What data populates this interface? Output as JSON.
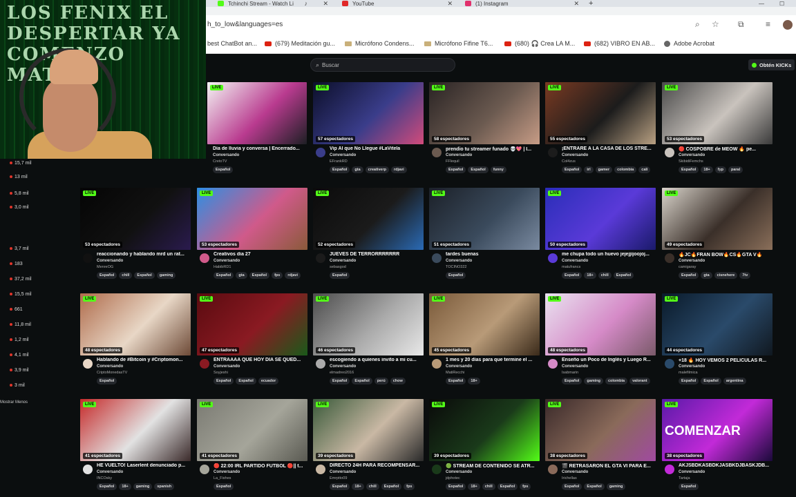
{
  "browser": {
    "tabs": [
      {
        "label": "Tchinchi Stream - Watch Li",
        "color": "#53fc18"
      },
      {
        "label": "YouTube",
        "color": "#e02828"
      },
      {
        "label": "(1) Instagram",
        "color": "#e1306c"
      }
    ],
    "new_tab": "+",
    "address": "h_to_low&languages=es",
    "bookmarks": [
      {
        "label": "best ChatBot an...",
        "icon": "none"
      },
      {
        "label": "(679) Meditación gu...",
        "icon": "youtube-icon"
      },
      {
        "label": "Micrófono Condens...",
        "icon": "folder-icon"
      },
      {
        "label": "Micrófono Fifine T6...",
        "icon": "folder-icon"
      },
      {
        "label": "(680) 🎧 Crea LA M...",
        "icon": "youtube-icon"
      },
      {
        "label": "(682) VIBRO EN AB...",
        "icon": "youtube-icon"
      },
      {
        "label": "Adobe Acrobat",
        "icon": "globe-icon"
      }
    ]
  },
  "webcam": {
    "overlay_text": "LOS FENIX EL DESPERTAR YA COMENZO MATRIX"
  },
  "header": {
    "search_placeholder": "Buscar",
    "kicks_button": "Obtén KICKs"
  },
  "sidebar": {
    "viewer_counts": [
      "15,7 mil",
      "13 mil",
      "5,8 mil",
      "3,0 mil",
      "3,7 mil",
      "183",
      "37,2 mil",
      "15,5 mil",
      "661",
      "11,8 mil",
      "1,2 mil",
      "4,1 mil",
      "3,9 mil",
      "3 mil"
    ],
    "show_less": "Mostrar Menos"
  },
  "streams": [
    {
      "viewers": "",
      "title": "Día de lluvia y conversa | Encerrado...",
      "category": "Conversando",
      "channel": "CretoTV",
      "tags": [
        "Español"
      ],
      "colors": [
        "#f4f4f4",
        "#b93b8f",
        "#1d1f24"
      ]
    },
    {
      "viewers": "57 espectadores",
      "title": "Vip Al que No Llegue #LaVitela",
      "category": "Conversando",
      "channel": "EFrankRD",
      "tags": [
        "Español",
        "gta",
        "creativerp",
        "rdjavi"
      ],
      "colors": [
        "#0c0f2a",
        "#3a3d8a",
        "#d24b7b"
      ]
    },
    {
      "viewers": "58 espectadores",
      "title": "prendio tu streamer funado 💀💖 | I...",
      "category": "Conversando",
      "channel": "FFlequil",
      "tags": [
        "Español",
        "Español",
        "funny"
      ],
      "colors": [
        "#2a2424",
        "#6b5a50",
        "#c79c86"
      ]
    },
    {
      "viewers": "55 espectadores",
      "title": "¡ENTRARE A LA CASA DE LOS STRE...",
      "category": "Conversando",
      "channel": "Col4zus",
      "tags": [
        "Español",
        "irl",
        "gamer",
        "colombia",
        "cali"
      ],
      "colors": [
        "#7a3a22",
        "#1c1c1c",
        "#b8a082"
      ]
    },
    {
      "viewers": "53 espectadores",
      "title": "🔴 COSPOBRE de MEOW 🔥 pe...",
      "category": "Conversando",
      "channel": "SkibidiFemchs",
      "tags": [
        "Español",
        "18+",
        "fyp",
        "paral"
      ],
      "colors": [
        "#4a4a4a",
        "#c9c3bd",
        "#3a3a3a"
      ]
    },
    {
      "viewers": "53 espectadores",
      "title": "reaccionando y hablando mrd un rat...",
      "category": "Conversando",
      "channel": "MenreOG",
      "tags": [
        "Español",
        "chill",
        "Español",
        "gaming"
      ],
      "colors": [
        "#050505",
        "#111",
        "#2a1b4e"
      ]
    },
    {
      "viewers": "53 espectadores",
      "title": "Creativos dia 27",
      "category": "Conversando",
      "channel": "HabibRD1",
      "tags": [
        "Español",
        "gta",
        "Español",
        "fps",
        "rdjavi"
      ],
      "colors": [
        "#2d8fe3",
        "#d05a8a",
        "#8a5a3a"
      ]
    },
    {
      "viewers": "52 espectadores",
      "title": "JUEVES DE TERRORRRRRRR",
      "category": "Conversando",
      "channel": "sebasgod",
      "tags": [
        "Español"
      ],
      "colors": [
        "#0b0b0b",
        "#1b1b1b",
        "#2a6ab5"
      ]
    },
    {
      "viewers": "51 espectadores",
      "title": "tardes buenas",
      "category": "Conversando",
      "channel": "TOCINO322",
      "tags": [
        "Español"
      ],
      "colors": [
        "#1c2129",
        "#3a4a5c",
        "#7a8aa0"
      ]
    },
    {
      "viewers": "50 espectadores",
      "title": "me chupa todo un huevo jejejjijoojoj...",
      "category": "Conversando",
      "channel": "matufrancs",
      "tags": [
        "Español",
        "18+",
        "chill",
        "Español"
      ],
      "colors": [
        "#2a2eb8",
        "#5a3ad8",
        "#1a1a6a"
      ]
    },
    {
      "viewers": "49 espectadores",
      "title": "🔥JC🔥FRAN BOW🔥CS🔥GTA V🔥",
      "category": "Conversando",
      "channel": "camigaray",
      "tags": [
        "Español",
        "gta",
        "cisnehere",
        "7tv"
      ],
      "colors": [
        "#d9d4cb",
        "#3a2f29",
        "#8a6f5a"
      ]
    },
    {
      "viewers": "48 espectadores",
      "title": "Hablando de #Bitcoin y #Criptomon...",
      "category": "Conversando",
      "channel": "CriptoMonedasTV",
      "tags": [
        "Español"
      ],
      "colors": [
        "#b06c4c",
        "#e8d7c6",
        "#6d4a37"
      ]
    },
    {
      "viewers": "47 espectadores",
      "title": "ENTRAAAA QUE HOY DIA SE QUED...",
      "category": "Conversando",
      "channel": "Soyjeshi",
      "tags": [
        "Español",
        "Español",
        "ecuador"
      ],
      "colors": [
        "#5a0b10",
        "#8a1a22",
        "#1a5a1a"
      ]
    },
    {
      "viewers": "46 espectadores",
      "title": "escogiendo a quienes invito a mi cu...",
      "category": "Conversando",
      "channel": "elmadreo2016",
      "tags": [
        "Español",
        "Español",
        "perú",
        "chow"
      ],
      "colors": [
        "#4c4c4c",
        "#aaaaaa",
        "#e8e8e8"
      ]
    },
    {
      "viewers": "45 espectadores",
      "title": "1 mes y 20 días para que termine el ...",
      "category": "Conversando",
      "channel": "MatiRecchi",
      "tags": [
        "Español",
        "18+"
      ],
      "colors": [
        "#7a5a3a",
        "#b89a78",
        "#3a2a1a"
      ]
    },
    {
      "viewers": "48 espectadores",
      "title": "Enseño un Poco de Inglés y Luego R...",
      "category": "Conversando",
      "channel": "Isabmarin",
      "tags": [
        "Español",
        "gaming",
        "colombia",
        "valorant"
      ],
      "colors": [
        "#e9e2f0",
        "#d58ac7",
        "#7a5a6a"
      ]
    },
    {
      "viewers": "44 espectadores",
      "title": "+18 🔥 HOY VEMOS 2 PELICULAS R...",
      "category": "Conversando",
      "channel": "malefilmica",
      "tags": [
        "Español",
        "Español",
        "argentina"
      ],
      "colors": [
        "#0a1a2a",
        "#2a4a6a",
        "#101820"
      ]
    },
    {
      "viewers": "41 espectadores",
      "title": "HE VUELTO! Laserlent denunciado p...",
      "category": "Conversando",
      "channel": "INCOsky",
      "tags": [
        "Español",
        "18+",
        "gaming",
        "spanish"
      ],
      "colors": [
        "#c62b2b",
        "#e2e2e2",
        "#3a2a2a"
      ]
    },
    {
      "viewers": "41 espectadores",
      "title": "🔴 22:00 IRL PARTIDO FUTBOL 🔴|| t...",
      "category": "Conversando",
      "channel": "La_Fishes",
      "tags": [
        "Español"
      ],
      "colors": [
        "#7a7a72",
        "#a5a59a",
        "#5a5a52"
      ]
    },
    {
      "viewers": "39 espectadores",
      "title": "DIRECTO 24H PARA RECOMPENSAR...",
      "category": "Conversando",
      "channel": "Emrptto09",
      "tags": [
        "Español",
        "18+",
        "chill",
        "Español",
        "fps"
      ],
      "colors": [
        "#3a5a3a",
        "#c9b8a4",
        "#2a2a2a"
      ]
    },
    {
      "viewers": "39 espectadores",
      "title": "🟢 STREAM DE CONTENIDO SE ATR...",
      "category": "Conversando",
      "channel": "jdphotec",
      "tags": [
        "Español",
        "18+",
        "chill",
        "Español",
        "fps"
      ],
      "colors": [
        "#0a0a0a",
        "#1a3a1a",
        "#53fc18"
      ]
    },
    {
      "viewers": "38 espectadores",
      "title": "🎬 RETRASARON EL GTA VI PARA E...",
      "category": "Conversando",
      "channel": "Irichellas",
      "tags": [
        "Español",
        "Español",
        "gaming"
      ],
      "colors": [
        "#3a2a2a",
        "#8a6a5a",
        "#a04aa0"
      ]
    },
    {
      "viewers": "38 espectadores",
      "title": "AKJSBDKASBDKJASBKDJBASKJDB...",
      "category": "Conversando",
      "channel": "Tartaja",
      "tags": [
        "Español"
      ],
      "colors": [
        "#5a1aa8",
        "#c22ad8",
        "#1a0a3a"
      ],
      "overlay": "COMENZAR"
    }
  ]
}
